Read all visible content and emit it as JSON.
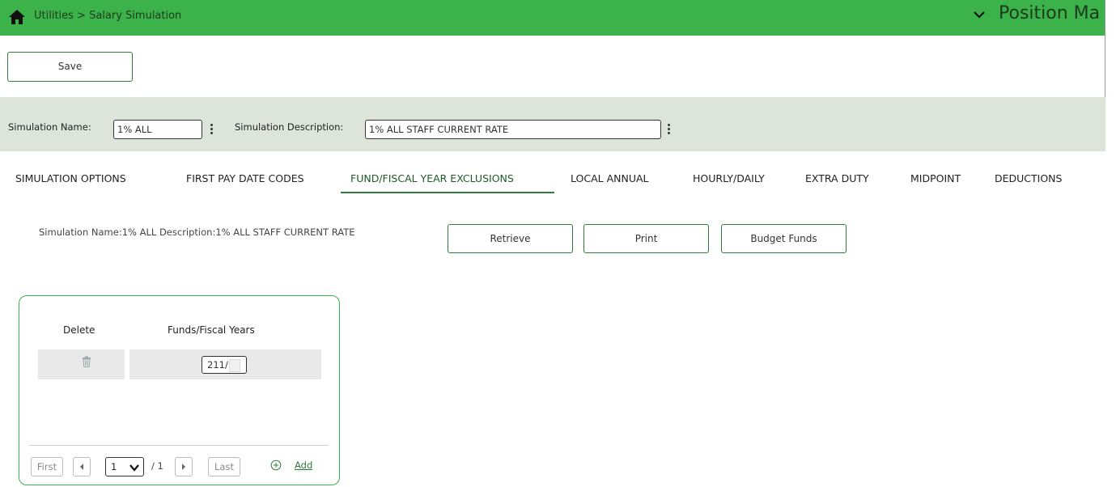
{
  "header": {
    "breadcrumb": "Utilities > Salary Simulation",
    "module_title": "Position Ma",
    "accent_color": "#3bb24a"
  },
  "toolbar": {
    "save_label": "Save"
  },
  "simulation_bar": {
    "name_label": "Simulation Name:",
    "name_value": "1% ALL",
    "desc_label": "Simulation Description:",
    "desc_value": "1% ALL STAFF CURRENT RATE"
  },
  "tabs": [
    {
      "label": "SIMULATION OPTIONS"
    },
    {
      "label": "FIRST PAY DATE CODES"
    },
    {
      "label": "FUND/FISCAL YEAR EXCLUSIONS",
      "active": true
    },
    {
      "label": "LOCAL ANNUAL"
    },
    {
      "label": "HOURLY/DAILY"
    },
    {
      "label": "EXTRA DUTY"
    },
    {
      "label": "MIDPOINT"
    },
    {
      "label": "DEDUCTIONS"
    }
  ],
  "info": {
    "text": "Simulation Name:1% ALL   Description:1% ALL STAFF CURRENT RATE"
  },
  "actions": {
    "retrieve": "Retrieve",
    "print": "Print",
    "budget_funds": "Budget Funds"
  },
  "grid": {
    "headers": {
      "delete": "Delete",
      "funds": "Funds/Fiscal Years"
    },
    "rows": [
      {
        "fund": "211/"
      }
    ]
  },
  "pager": {
    "first": "First",
    "last": "Last",
    "current_page": "1",
    "total": "/ 1",
    "add": "Add"
  },
  "icons": [
    "home-icon",
    "chevron-down-icon",
    "more-vert-icon",
    "trash-icon",
    "prev-icon",
    "next-icon",
    "add-circle-icon"
  ]
}
